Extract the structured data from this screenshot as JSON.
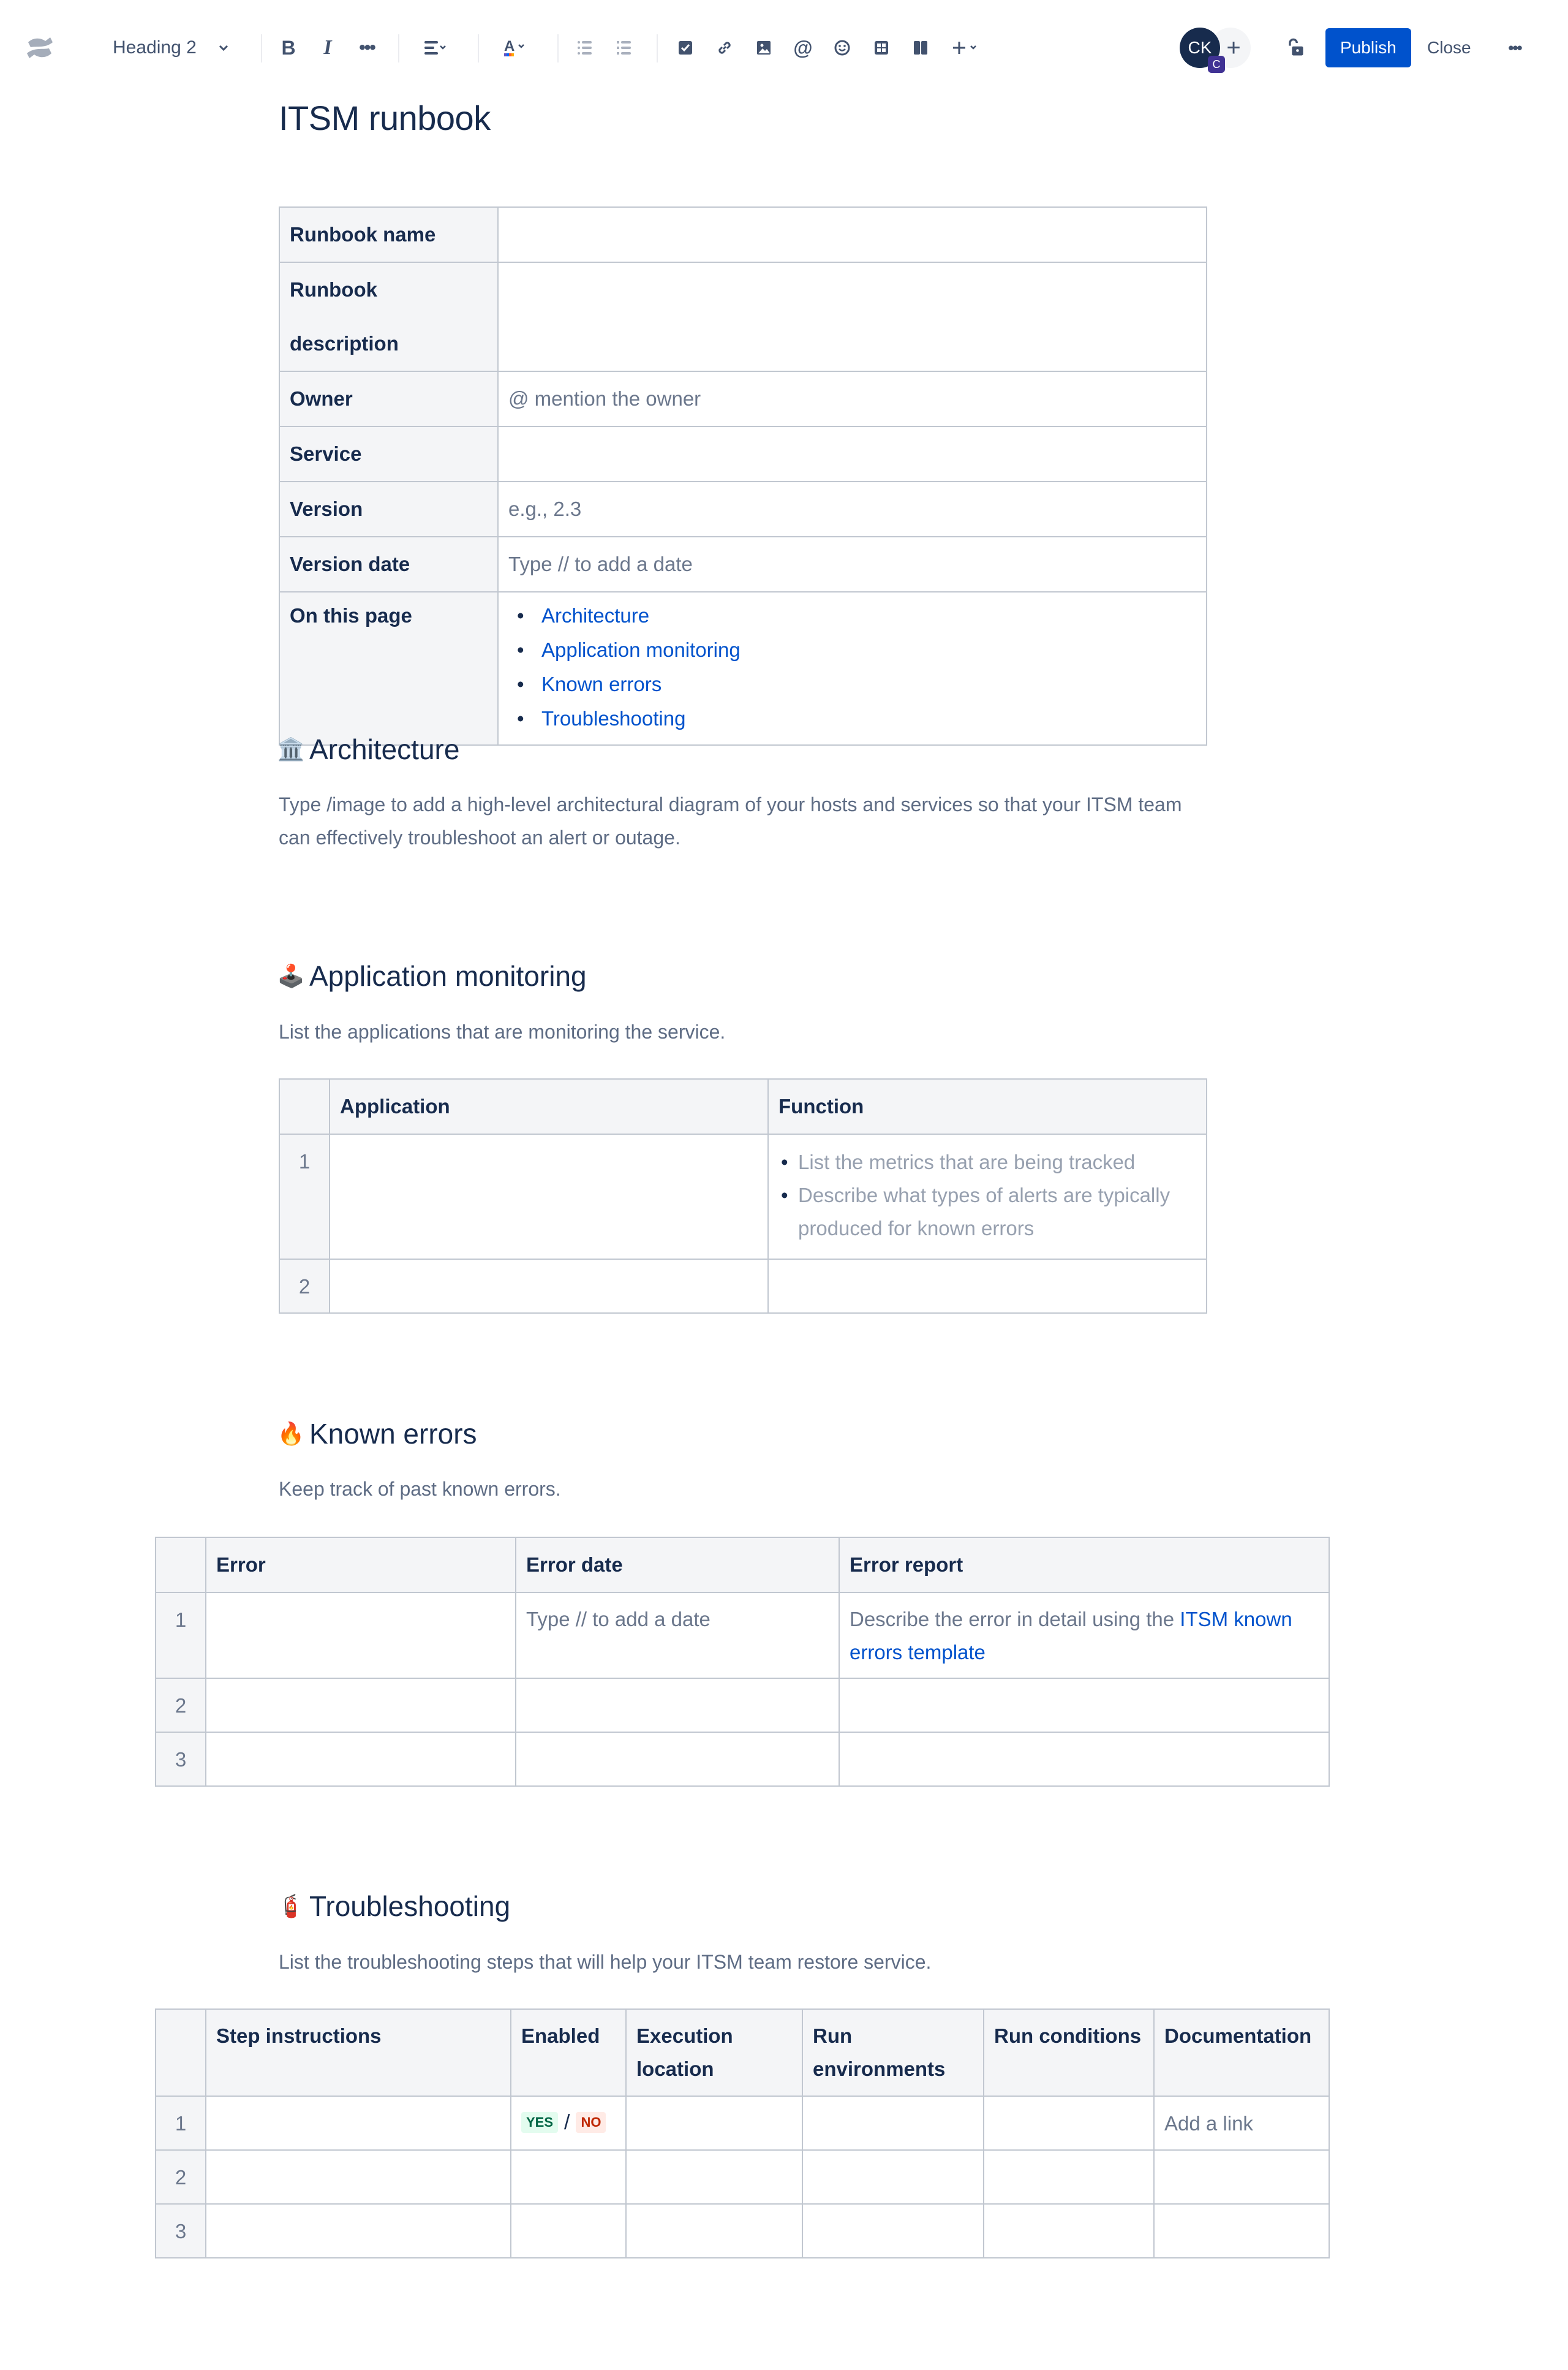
{
  "toolbar": {
    "text_style": "Heading 2",
    "icons": {
      "bold": "bold-icon",
      "italic": "italic-icon",
      "more_formatting": "more-formatting-icon",
      "align": "align-icon",
      "text_color": "text-color-icon",
      "bullet_list": "bullet-list-icon",
      "numbered_list": "numbered-list-icon",
      "action_item": "checkbox-icon",
      "link": "link-icon",
      "image": "image-icon",
      "mention": "mention-icon",
      "emoji": "emoji-icon",
      "table": "table-icon",
      "layouts": "layout-icon",
      "insert": "plus-icon"
    },
    "avatar_initials": "CK",
    "avatar_badge": "C",
    "publish_label": "Publish",
    "close_label": "Close"
  },
  "page": {
    "title": "ITSM runbook"
  },
  "info_table": {
    "rows": [
      {
        "label": "Runbook name",
        "value": ""
      },
      {
        "label": "Runbook description",
        "value": ""
      },
      {
        "label": "Owner",
        "value": "@ mention the owner"
      },
      {
        "label": "Service",
        "value": ""
      },
      {
        "label": "Version",
        "value": "e.g., 2.3"
      },
      {
        "label": "Version date",
        "value": "Type // to add a date"
      }
    ],
    "toc_label": "On this page",
    "toc": [
      "Architecture",
      "Application monitoring",
      "Known errors",
      "Troubleshooting"
    ]
  },
  "sections": {
    "architecture": {
      "emoji": "🏛️",
      "heading": "Architecture",
      "text": "Type /image to add a high-level architectural diagram of your hosts and services so that your ITSM team can effectively troubleshoot an alert or outage."
    },
    "app_monitoring": {
      "emoji": "🕹️",
      "heading": "Application monitoring",
      "text": "List the applications that are monitoring the service.",
      "table": {
        "headers": [
          "",
          "Application",
          "Function"
        ],
        "rows": [
          {
            "num": "1",
            "application": "",
            "function_bullets": [
              "List the metrics that are being tracked",
              "Describe what types of alerts are typically produced for known errors"
            ]
          },
          {
            "num": "2",
            "application": "",
            "function_bullets": []
          }
        ]
      }
    },
    "known_errors": {
      "emoji": "🔥",
      "heading": "Known errors",
      "text": "Keep track of past known errors.",
      "table": {
        "headers": [
          "",
          "Error",
          "Error date",
          "Error report"
        ],
        "rows": [
          {
            "num": "1",
            "error": "",
            "date": "Type // to add a date",
            "report_prefix": "Describe the error in detail using the ",
            "report_link": "ITSM known errors template"
          },
          {
            "num": "2",
            "error": "",
            "date": "",
            "report_prefix": "",
            "report_link": ""
          },
          {
            "num": "3",
            "error": "",
            "date": "",
            "report_prefix": "",
            "report_link": ""
          }
        ]
      }
    },
    "troubleshooting": {
      "emoji": "🧯",
      "heading": "Troubleshooting",
      "text": "List the troubleshooting steps that will help your ITSM team restore service.",
      "table": {
        "headers": [
          "",
          "Step instructions",
          "Enabled",
          "Execution location",
          "Run environments",
          "Run conditions",
          "Documentation"
        ],
        "rows": [
          {
            "num": "1",
            "enabled_yes": "YES",
            "enabled_sep": "/",
            "enabled_no": "NO",
            "documentation": "Add a link"
          },
          {
            "num": "2"
          },
          {
            "num": "3"
          }
        ]
      }
    }
  },
  "colors": {
    "primary": "#0052cc",
    "text": "#172b4d",
    "subtle_text": "#5e6c84",
    "header_bg": "#f4f5f7",
    "border": "#c1c7d0",
    "yes_bg": "#e3fcef",
    "yes_fg": "#006644",
    "no_bg": "#ffebe6",
    "no_fg": "#bf2600"
  }
}
